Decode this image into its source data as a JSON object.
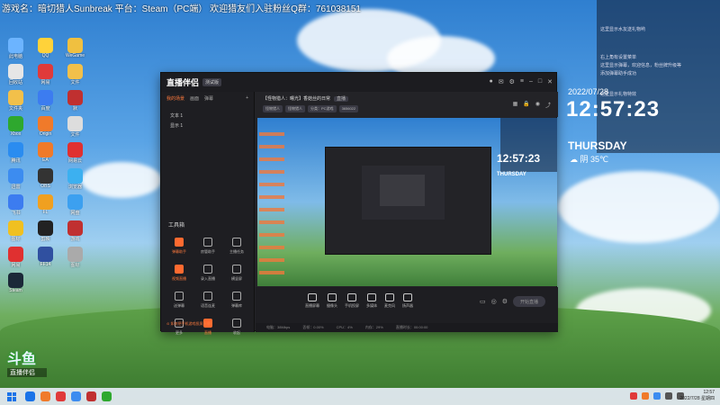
{
  "banner": {
    "text": "游戏名：暗切猎人Sunbreak  平台：Steam（PC端） 欢迎猎友们入驻粉丝Q群：761038151"
  },
  "desktop": {
    "icons": [
      {
        "label": "此电脑",
        "color": "#6cb4ff"
      },
      {
        "label": "QQ",
        "color": "#ffd23a"
      },
      {
        "label": "WeGame",
        "color": "#f0c040"
      },
      {
        "label": "回收站",
        "color": "#e6e6e6"
      },
      {
        "label": "网易",
        "color": "#e03a3a"
      },
      {
        "label": "文件",
        "color": "#f2c04a"
      },
      {
        "label": "文件夹",
        "color": "#f2c04a"
      },
      {
        "label": "百度",
        "color": "#3c7cf0"
      },
      {
        "label": "默",
        "color": "#c03030"
      },
      {
        "label": "Xbox",
        "color": "#2ea82e"
      },
      {
        "label": "Origin",
        "color": "#f07a2a"
      },
      {
        "label": "文件",
        "color": "#dddddd"
      },
      {
        "label": "腾讯",
        "color": "#2a8cf0"
      },
      {
        "label": "EA",
        "color": "#f07a2a"
      },
      {
        "label": "网易云",
        "color": "#e03030"
      },
      {
        "label": "迅雷",
        "color": "#3c8cf0"
      },
      {
        "label": "OBS",
        "color": "#333333"
      },
      {
        "label": "浏览器",
        "color": "#3cb0f0"
      },
      {
        "label": "飞书",
        "color": "#3c7cf0"
      },
      {
        "label": "FL",
        "color": "#f0a020"
      },
      {
        "label": "网盘",
        "color": "#3ca0f0"
      },
      {
        "label": "图标",
        "color": "#f0c020"
      },
      {
        "label": "剪映",
        "color": "#222222"
      },
      {
        "label": "游戏",
        "color": "#c03030"
      },
      {
        "label": "网易",
        "color": "#e03030"
      },
      {
        "label": "FF14",
        "color": "#3050a0"
      },
      {
        "label": "图标",
        "color": "#aaaaaa"
      },
      {
        "label": "Steam",
        "color": "#1b2838"
      }
    ]
  },
  "rightpanel": {
    "rows": [
      "这里显示水友送礼物哟",
      "右上角有设置菜单",
      "这里显示弹幕，欢迎信息，粉丝牌升级等",
      "添加弹幕助手成功",
      "这里显示礼物特效"
    ],
    "date": "2022/07/28",
    "clock": "12:57:23",
    "weekday": "THURSDAY",
    "weather": "☁ 阴 35℃"
  },
  "app": {
    "logo": "直播伴侣",
    "version": "测试版",
    "left_tabs": [
      "我的场景",
      "画面",
      "弹幕"
    ],
    "scenes": [
      "文本 1",
      "显示 1"
    ],
    "tools_title": "工具箱",
    "tools": [
      {
        "label": "弹幕助手",
        "hot": true
      },
      {
        "label": "房管助手",
        "hot": false
      },
      {
        "label": "主播任务",
        "hot": false
      },
      {
        "label": "视频直播",
        "hot": true
      },
      {
        "label": "录入直播",
        "hot": false
      },
      {
        "label": "横竖屏",
        "hot": false
      },
      {
        "label": "送弹幕",
        "hot": false
      },
      {
        "label": "语音连麦",
        "hot": false
      },
      {
        "label": "弹幕库",
        "hot": false
      },
      {
        "label": "更多",
        "hot": false
      },
      {
        "label": "直播",
        "hot": true
      },
      {
        "label": "收起",
        "hot": false
      }
    ],
    "left_footer": "⊙ 如何把手机游戏投屏直播？",
    "room_title": "【怪物猎人：曙光】香菇丝的日常",
    "room_tag": "直播",
    "room_tags": [
      "怪物猎人",
      "怪物猎人",
      "分类：PC游戏",
      "3656022"
    ],
    "bottom_items": [
      "直播屏幕",
      "摄像头",
      "手机投屏",
      "多媒体",
      "麦克风",
      "扬声器"
    ],
    "start_label": "开始直播",
    "status": [
      "电脑：38Mbps",
      "丢帧：0.00%",
      "CPU：4%",
      "内存：29%",
      "直播时长：00:00:00"
    ]
  },
  "overlay_logo": {
    "main": "斗鱼",
    "sub": "直播伴侣"
  },
  "taskbar": {
    "apps": [
      "#1a73e8",
      "#f07a2a",
      "#e03a3a",
      "#3c8cf0",
      "#c03030",
      "#2ea82e"
    ],
    "time": "12:57",
    "date": "2022/7/28 星期四"
  }
}
